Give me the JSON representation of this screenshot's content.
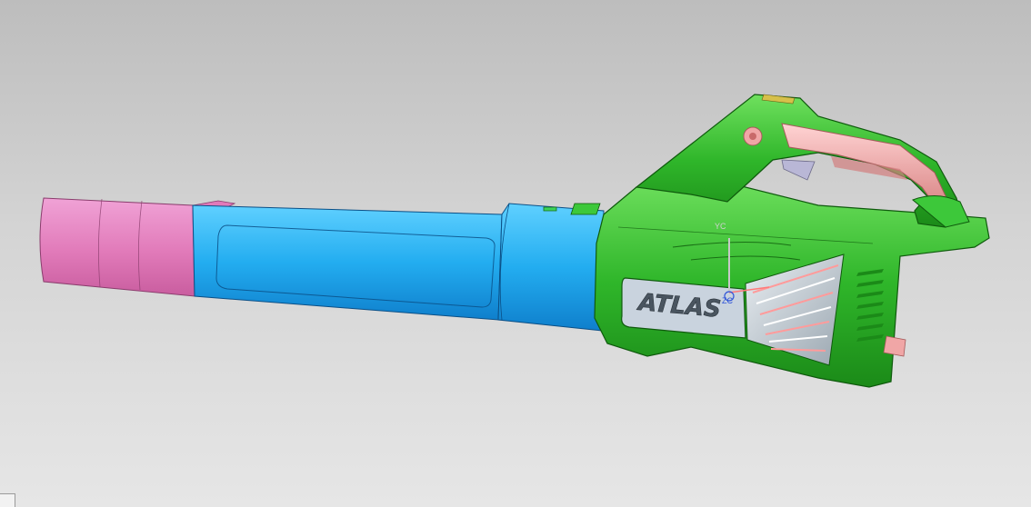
{
  "model": {
    "brand_label": "ATLAS"
  },
  "triad": {
    "y_label": "YC",
    "z_label": "ZC"
  },
  "colors": {
    "nozzle_tip": "#e87cc0",
    "tube": "#23aef0",
    "housing": "#2fb62a",
    "handle_grip": "#f0a6a6",
    "background_top": "#bdbdbd",
    "background_bottom": "#e6e6e6"
  },
  "icons": {
    "view_triad": "axis-triad-icon",
    "corner": "view-corner-icon"
  }
}
